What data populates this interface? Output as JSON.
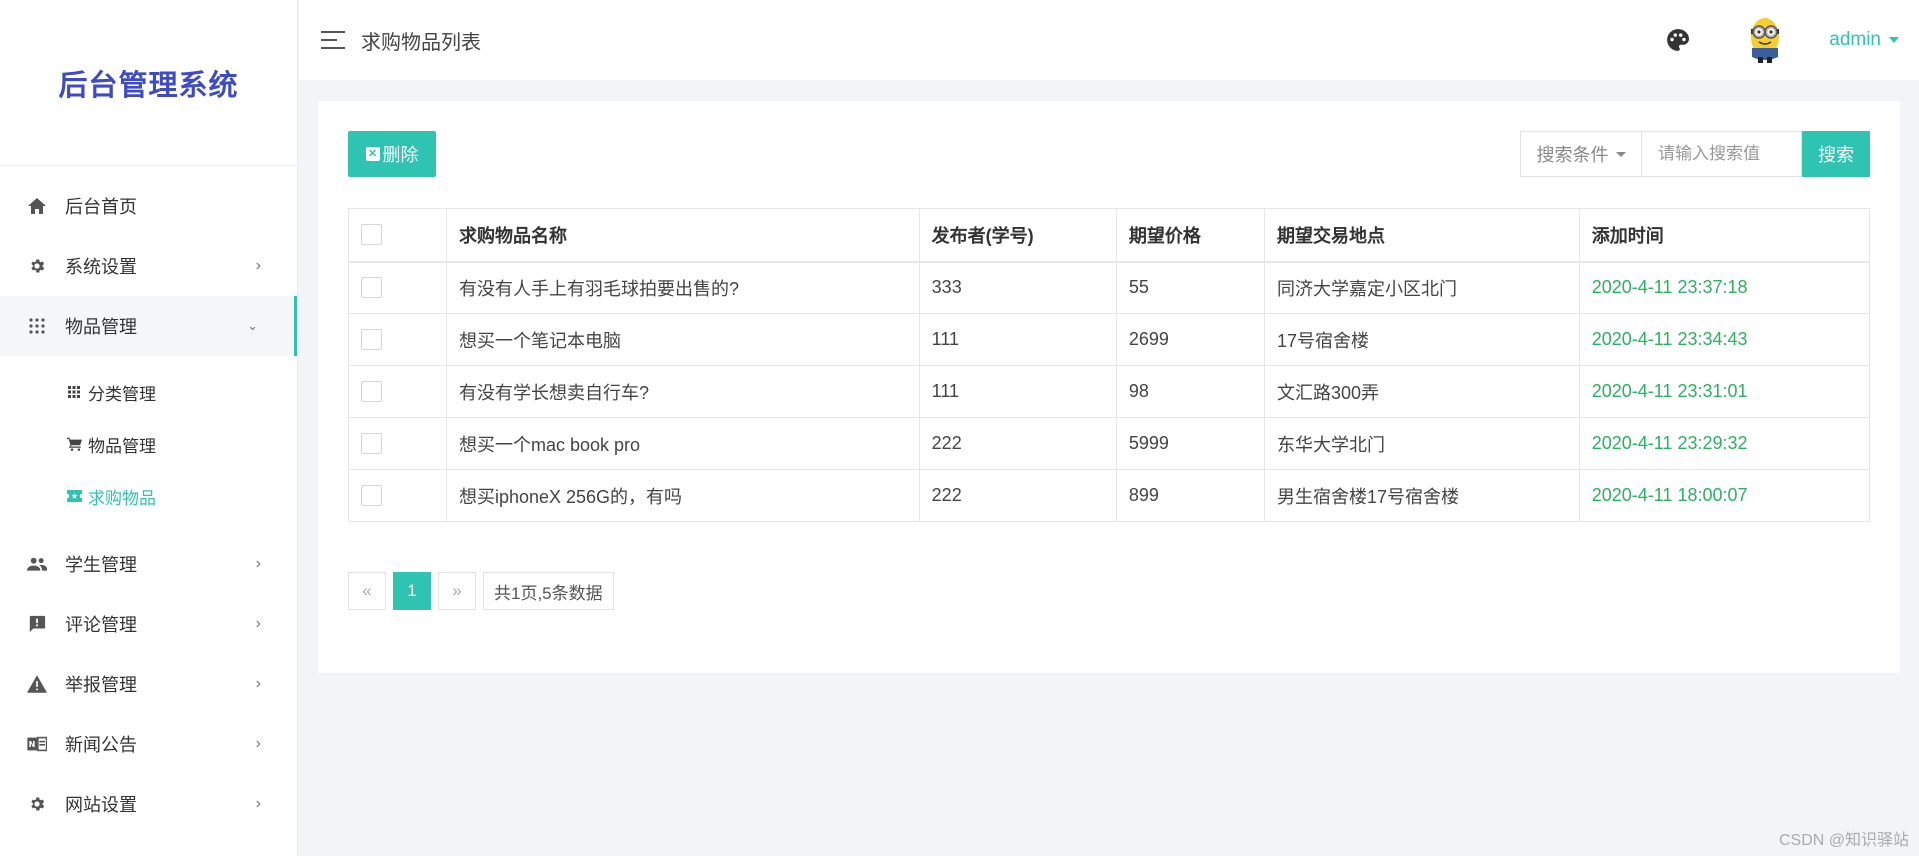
{
  "sidebar": {
    "brand": "后台管理系统",
    "items": [
      {
        "label": "后台首页",
        "icon": "home-icon"
      },
      {
        "label": "系统设置",
        "icon": "gear-icon"
      },
      {
        "label": "物品管理",
        "icon": "grid-icon",
        "expanded": true,
        "children": [
          {
            "label": "分类管理",
            "icon": "grid-small-icon"
          },
          {
            "label": "物品管理",
            "icon": "cart-icon"
          },
          {
            "label": "求购物品",
            "icon": "ticket-icon",
            "active": true
          }
        ]
      },
      {
        "label": "学生管理",
        "icon": "people-icon"
      },
      {
        "label": "评论管理",
        "icon": "comment-icon"
      },
      {
        "label": "举报管理",
        "icon": "warning-icon"
      },
      {
        "label": "新闻公告",
        "icon": "news-icon"
      },
      {
        "label": "网站设置",
        "icon": "gear-icon"
      }
    ]
  },
  "topbar": {
    "title": "求购物品列表",
    "user": "admin"
  },
  "toolbar": {
    "delete_label": "删除",
    "search_condition": "搜索条件",
    "search_placeholder": "请输入搜索值",
    "search_label": "搜索"
  },
  "table": {
    "columns": [
      "求购物品名称",
      "发布者(学号)",
      "期望价格",
      "期望交易地点",
      "添加时间"
    ],
    "rows": [
      [
        "有没有人手上有羽毛球拍要出售的?",
        "333",
        "55",
        "同济大学嘉定小区北门",
        "2020-4-11 23:37:18"
      ],
      [
        "想买一个笔记本电脑",
        "111",
        "2699",
        "17号宿舍楼",
        "2020-4-11 23:34:43"
      ],
      [
        "有没有学长想卖自行车?",
        "111",
        "98",
        "文汇路300弄",
        "2020-4-11 23:31:01"
      ],
      [
        "想买一个mac book pro",
        "222",
        "5999",
        "东华大学北门",
        "2020-4-11 23:29:32"
      ],
      [
        "想买iphoneX 256G的，有吗",
        "222",
        "899",
        "男生宿舍楼17号宿舍楼",
        "2020-4-11 18:00:07"
      ]
    ]
  },
  "pagination": {
    "prev": "«",
    "current": "1",
    "next": "»",
    "info": "共1页,5条数据"
  },
  "watermark": "CSDN @知识驿站",
  "colors": {
    "accent": "#2ec4b1",
    "brand": "#3f4bc4",
    "time": "#28b35f"
  }
}
